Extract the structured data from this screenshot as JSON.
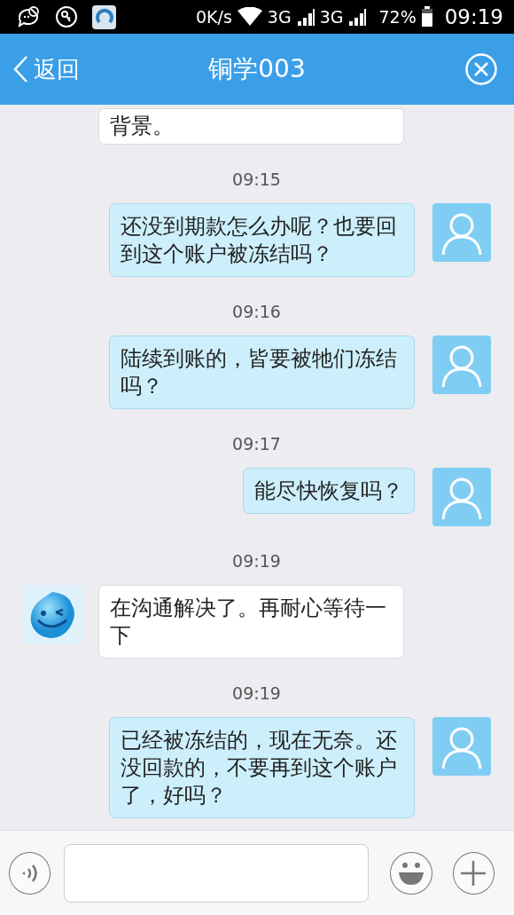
{
  "status_bar": {
    "network_speed": "0K/s",
    "networks": [
      "3G",
      "3G"
    ],
    "battery": "72%",
    "time": "09:19"
  },
  "header": {
    "back_label": "返回",
    "title": "铜学003"
  },
  "messages": [
    {
      "kind": "received",
      "avatar": false,
      "text": "背景。"
    },
    {
      "kind": "timestamp",
      "text": "09:15"
    },
    {
      "kind": "sent",
      "text": "还没到期款怎么办呢？也要回到这个账户被冻结吗？"
    },
    {
      "kind": "timestamp",
      "text": "09:16"
    },
    {
      "kind": "sent",
      "text": "陆续到账的，皆要被牠们冻结吗？"
    },
    {
      "kind": "timestamp",
      "text": "09:17"
    },
    {
      "kind": "sent",
      "text": "能尽快恢复吗？"
    },
    {
      "kind": "timestamp",
      "text": "09:19"
    },
    {
      "kind": "received",
      "avatar": true,
      "text": "在沟通解决了。再耐心等待一下"
    },
    {
      "kind": "timestamp",
      "text": "09:19"
    },
    {
      "kind": "sent",
      "text": "已经被冻结的，现在无奈。还没回款的，不要再到这个账户了，好吗？"
    }
  ]
}
